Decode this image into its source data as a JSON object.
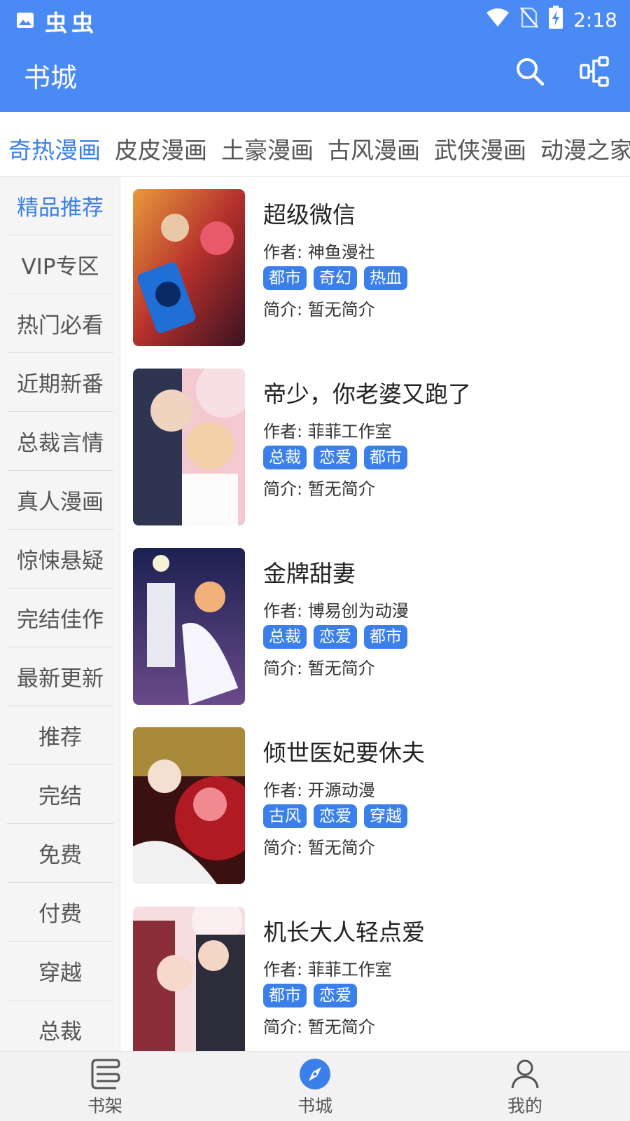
{
  "status_bar": {
    "app_glyphs": "虫虫",
    "time": "2:18",
    "icons": [
      "image-icon",
      "wifi-icon",
      "no-sim-icon",
      "battery-charging-icon"
    ]
  },
  "app_bar": {
    "title": "书城",
    "icons": [
      "search-icon",
      "share-nodes-icon"
    ]
  },
  "tabs": [
    {
      "label": "奇热漫画",
      "active": true
    },
    {
      "label": "皮皮漫画",
      "active": false
    },
    {
      "label": "土豪漫画",
      "active": false
    },
    {
      "label": "古风漫画",
      "active": false
    },
    {
      "label": "武侠漫画",
      "active": false
    },
    {
      "label": "动漫之家",
      "active": false
    }
  ],
  "sidebar": {
    "items": [
      {
        "label": "精品推荐",
        "active": true
      },
      {
        "label": "VIP专区",
        "active": false
      },
      {
        "label": "热门必看",
        "active": false
      },
      {
        "label": "近期新番",
        "active": false
      },
      {
        "label": "总裁言情",
        "active": false
      },
      {
        "label": "真人漫画",
        "active": false
      },
      {
        "label": "惊悚悬疑",
        "active": false
      },
      {
        "label": "完结佳作",
        "active": false
      },
      {
        "label": "最新更新",
        "active": false
      },
      {
        "label": "推荐",
        "active": false
      },
      {
        "label": "完结",
        "active": false
      },
      {
        "label": "免费",
        "active": false
      },
      {
        "label": "付费",
        "active": false
      },
      {
        "label": "穿越",
        "active": false
      },
      {
        "label": "总裁",
        "active": false
      }
    ]
  },
  "books": [
    {
      "title": "超级微信",
      "author": "作者: 神鱼漫社",
      "tags": [
        "都市",
        "奇幻",
        "热血"
      ],
      "intro": "简介: 暂无简介"
    },
    {
      "title": "帝少，你老婆又跑了",
      "author": "作者: 菲菲工作室",
      "tags": [
        "总裁",
        "恋爱",
        "都市"
      ],
      "intro": "简介: 暂无简介"
    },
    {
      "title": "金牌甜妻",
      "author": "作者: 博易创为动漫",
      "tags": [
        "总裁",
        "恋爱",
        "都市"
      ],
      "intro": "简介: 暂无简介"
    },
    {
      "title": "倾世医妃要休夫",
      "author": "作者: 开源动漫",
      "tags": [
        "古风",
        "恋爱",
        "穿越"
      ],
      "intro": "简介: 暂无简介"
    },
    {
      "title": "机长大人轻点爱",
      "author": "作者: 菲菲工作室",
      "tags": [
        "都市",
        "恋爱"
      ],
      "intro": "简介: 暂无简介"
    }
  ],
  "bottom_nav": [
    {
      "label": "书架",
      "icon": "bookshelf-icon",
      "active": false
    },
    {
      "label": "书城",
      "icon": "compass-icon",
      "active": true
    },
    {
      "label": "我的",
      "icon": "person-icon",
      "active": false
    }
  ],
  "colors": {
    "primary": "#4a8af4",
    "accent": "#3b80ea",
    "tag_bg": "#3b80ea",
    "sidebar_bg": "#f5f5f5"
  }
}
